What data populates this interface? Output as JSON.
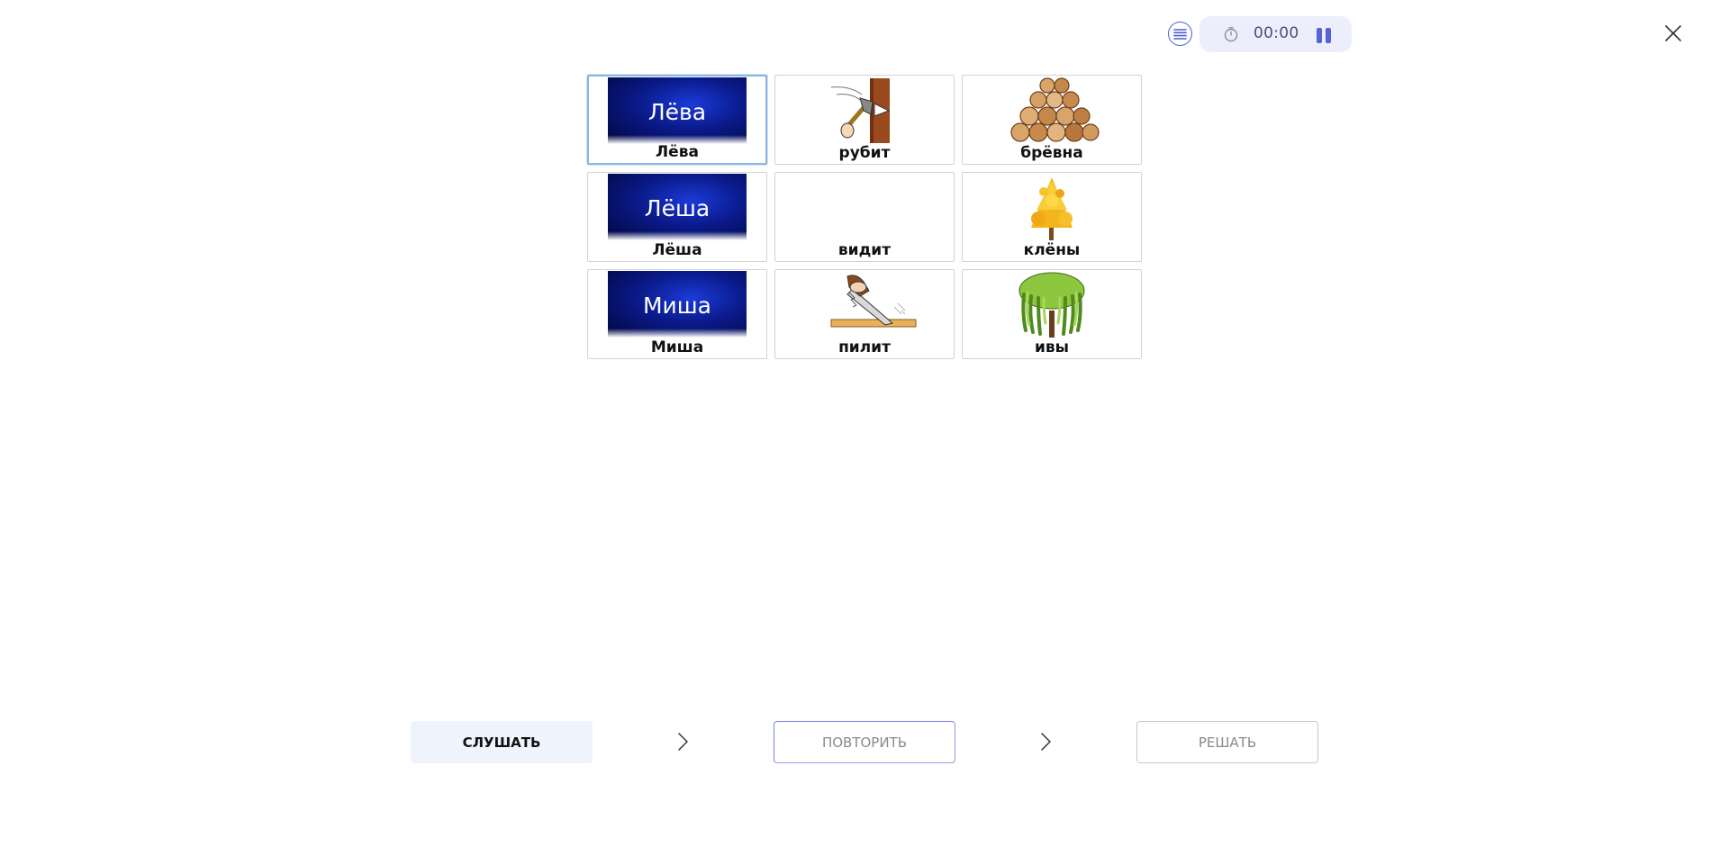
{
  "header": {
    "timer": "00:00",
    "icons": {
      "list": "list-icon",
      "timer": "stopwatch-icon",
      "pause": "pause-icon",
      "close": "close-icon"
    }
  },
  "cards": [
    {
      "label": "Лёва",
      "image": "name",
      "image_text": "Лёва",
      "selected": true
    },
    {
      "label": "рубит",
      "image": "axe-chopping"
    },
    {
      "label": "брёвна",
      "image": "log-pile"
    },
    {
      "label": "Лёша",
      "image": "name",
      "image_text": "Лёша"
    },
    {
      "label": "видит",
      "image": "none"
    },
    {
      "label": "клёны",
      "image": "maple-tree"
    },
    {
      "label": "Миша",
      "image": "name",
      "image_text": "Миша"
    },
    {
      "label": "пилит",
      "image": "hand-saw"
    },
    {
      "label": "ивы",
      "image": "willow-tree"
    }
  ],
  "steps": {
    "listen": "СЛУШАТЬ",
    "repeat": "ПОВТОРИТЬ",
    "solve": "РЕШАТЬ"
  },
  "colors": {
    "accent": "#5563d9",
    "timer_bg": "#eceefb",
    "listen_bg": "#eef3fd",
    "selected_border": "#8ab6e0"
  }
}
